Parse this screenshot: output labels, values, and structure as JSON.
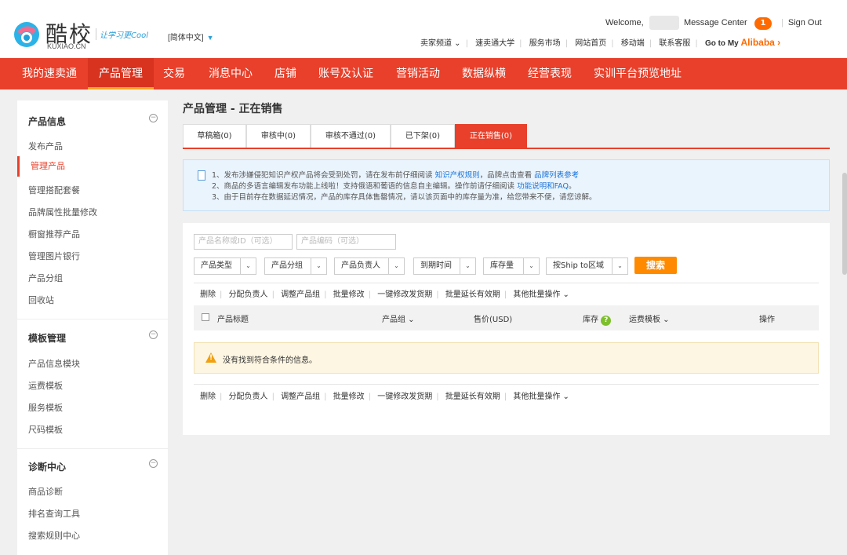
{
  "header": {
    "logo_cn": "酷校",
    "logo_en": "KUXIAO.CN",
    "slogan": "让学习更Cool",
    "language": "[简体中文]",
    "welcome": "Welcome,",
    "message_center": "Message Center",
    "message_count": "1",
    "sign_out": "Sign Out",
    "top_links": [
      "卖家频道 ⌄",
      "速卖通大学",
      "服务市场",
      "网站首页",
      "移动端",
      "联系客服"
    ],
    "goto_prefix": "Go to My",
    "goto_brand": "Alibaba ›"
  },
  "nav": {
    "items": [
      "我的速卖通",
      "产品管理",
      "交易",
      "消息中心",
      "店铺",
      "账号及认证",
      "营销活动",
      "数据纵横",
      "经营表现",
      "实训平台预览地址"
    ],
    "active": "产品管理"
  },
  "sidebar": {
    "groups": [
      {
        "title": "产品信息",
        "items": [
          "发布产品",
          "管理产品",
          "管理搭配套餐",
          "品牌属性批量修改",
          "橱窗推荐产品",
          "管理图片银行",
          "产品分组",
          "回收站"
        ]
      },
      {
        "title": "模板管理",
        "items": [
          "产品信息模块",
          "运费模板",
          "服务模板",
          "尺码模板"
        ]
      },
      {
        "title": "诊断中心",
        "items": [
          "商品诊断",
          "排名查询工具",
          "搜索规则中心"
        ]
      }
    ],
    "active_item": "管理产品",
    "collapse_glyph": "−"
  },
  "main": {
    "title": "产品管理 - 正在销售",
    "tabs": [
      "草稿箱(0)",
      "审核中(0)",
      "审核不通过(0)",
      "已下架(0)",
      "正在销售(0)"
    ],
    "active_tab": "正在销售(0)",
    "notice": [
      {
        "text": "1、发布涉嫌侵犯知识产权产品将会受到处罚，请在发布前仔细阅读 ",
        "link": "知识产权规则",
        "text2": "，品牌点击查看 ",
        "link2": "品牌列表参考"
      },
      {
        "text": "2、商品的多语言编辑发布功能上线啦！支持俄语和葡语的信息自主编辑。操作前请仔细阅读 ",
        "link": "功能说明和FAQ",
        "text2": "。",
        "link2": ""
      },
      {
        "text": "3、由于目前存在数据延迟情况，产品的库存具体售罄情况，请以该页面中的库存量为准，给您带来不便，请您谅解。",
        "link": "",
        "text2": "",
        "link2": ""
      }
    ],
    "filters": {
      "name_placeholder": "产品名称或ID（可选）",
      "code_placeholder": "产品编码（可选）",
      "selects": [
        "产品类型",
        "产品分组",
        "产品负责人",
        "到期时间",
        "库存量",
        "按Ship to区域"
      ],
      "search_label": "搜索"
    },
    "batch_actions": [
      "删除",
      "分配负责人",
      "调整产品组",
      "批量修改",
      "一键修改发货期",
      "批量延长有效期",
      "其他批量操作 ⌄"
    ],
    "table_headers": {
      "title": "产品标题",
      "group": "产品组 ⌄",
      "price": "售价(USD)",
      "stock": "库存",
      "shipping": "运费模板 ⌄",
      "action": "操作"
    },
    "empty_message": "没有找到符合条件的信息。"
  },
  "colors": {
    "nav_bg": "#e8402b",
    "accent": "#ff6a00",
    "search_btn": "#ff8a00",
    "link": "#1a73d9"
  }
}
